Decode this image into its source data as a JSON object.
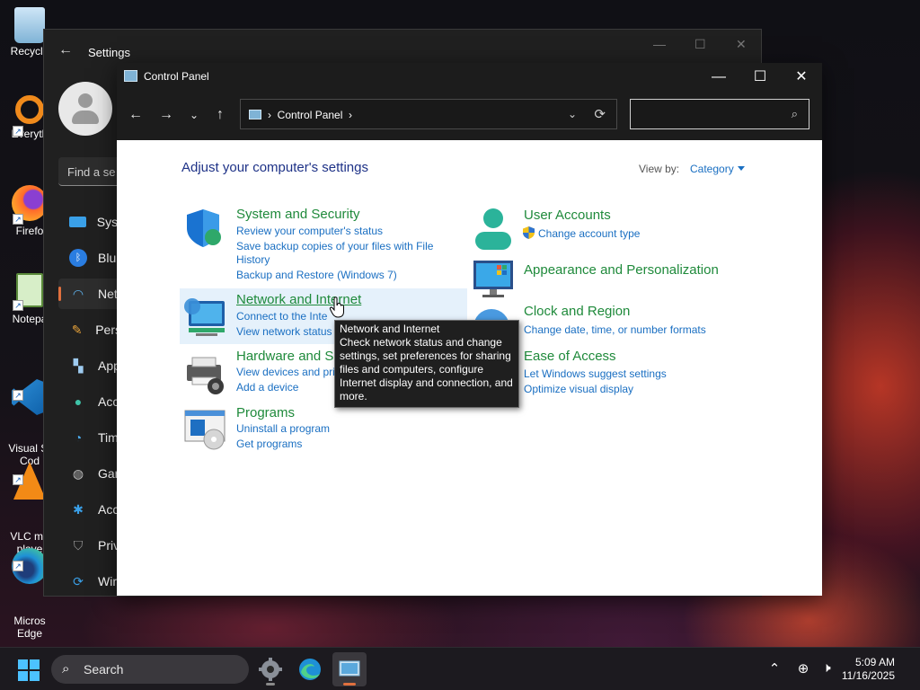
{
  "desktop": {
    "icons": [
      {
        "label": "Recycle",
        "icon": "recycle-bin-icon"
      },
      {
        "label": "Everyth",
        "icon": "everything-search-icon"
      },
      {
        "label": "Firefo",
        "icon": "firefox-icon"
      },
      {
        "label": "Notepa",
        "icon": "notepad-icon"
      },
      {
        "label": "Visual St\nCod",
        "icon": "vscode-icon"
      },
      {
        "label": "VLC me\nplaye",
        "icon": "vlc-icon"
      },
      {
        "label": "Micros\nEdge",
        "icon": "edge-icon"
      }
    ]
  },
  "settings_window": {
    "title": "Settings",
    "search_placeholder": "Find a se",
    "items": [
      {
        "label": "Syst",
        "icon": "system-icon"
      },
      {
        "label": "Blu",
        "icon": "bluetooth-icon"
      },
      {
        "label": "Net",
        "icon": "wifi-icon",
        "selected": true
      },
      {
        "label": "Pers",
        "icon": "brush-icon"
      },
      {
        "label": "App",
        "icon": "apps-icon"
      },
      {
        "label": "Acc",
        "icon": "accounts-icon"
      },
      {
        "label": "Tim",
        "icon": "time-language-icon"
      },
      {
        "label": "Gar",
        "icon": "gaming-icon"
      },
      {
        "label": "Acc",
        "icon": "accessibility-icon"
      },
      {
        "label": "Priv",
        "icon": "privacy-shield-icon"
      },
      {
        "label": "Wir",
        "icon": "windows-update-icon"
      }
    ]
  },
  "control_panel": {
    "title": "Control Panel",
    "address": {
      "crumb": "Control Panel"
    },
    "search_value": "",
    "heading": "Adjust your computer's settings",
    "view_by_label": "View by:",
    "view_by_value": "Category",
    "categories": {
      "system_security": {
        "title": "System and Security",
        "links": [
          "Review your computer's status",
          "Save backup copies of your files with File",
          "History",
          "Backup and Restore (Windows 7)"
        ]
      },
      "network": {
        "title": "Network and Internet",
        "links": [
          "Connect to the Inte",
          "View network status"
        ]
      },
      "hardware": {
        "title": "Hardware and S",
        "links": [
          "View devices and pri",
          "Add a device"
        ]
      },
      "programs": {
        "title": "Programs",
        "links": [
          "Uninstall a program",
          "Get programs"
        ]
      },
      "user_accounts": {
        "title": "User Accounts",
        "links": [
          "Change account type"
        ]
      },
      "appearance": {
        "title": "Appearance and Personalization",
        "links": []
      },
      "clock_region": {
        "title": "Clock and Region",
        "links": [
          "Change date, time, or number formats"
        ]
      },
      "ease_access": {
        "title": "Ease of Access",
        "links": [
          "Let Windows suggest settings",
          "Optimize visual display"
        ]
      }
    },
    "tooltip": {
      "title": "Network and Internet",
      "body": "Check network status and change settings, set preferences for sharing files and computers, configure Internet display and connection, and more."
    }
  },
  "taskbar": {
    "search_label": "Search",
    "apps": [
      "settings-gear-icon",
      "edge-icon",
      "control-panel-icon"
    ],
    "time": "5:09 AM",
    "date": "11/16/2025"
  },
  "colors": {
    "category_green": "#1f8a3b",
    "link_blue": "#1a6fc2",
    "heading_navy": "#1e3287",
    "accent_orange": "#e0703e"
  }
}
